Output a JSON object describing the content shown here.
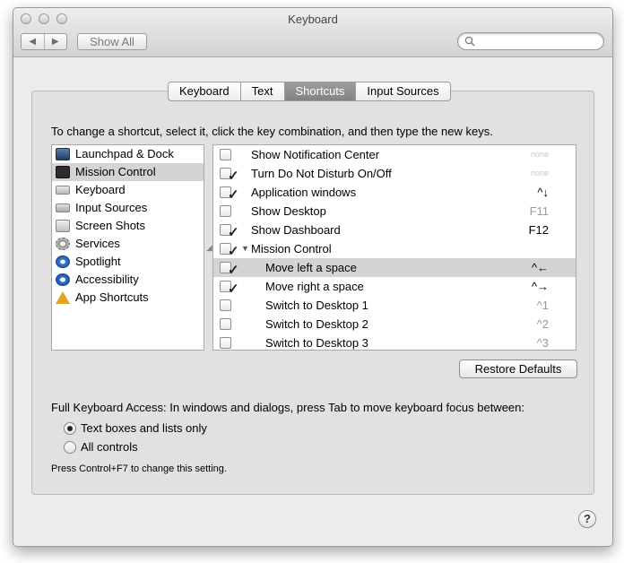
{
  "window": {
    "title": "Keyboard",
    "show_all_label": "Show All",
    "nav_back": "◀",
    "nav_forward": "▶",
    "search_placeholder": ""
  },
  "tabs": [
    {
      "label": "Keyboard",
      "active": false
    },
    {
      "label": "Text",
      "active": false
    },
    {
      "label": "Shortcuts",
      "active": true
    },
    {
      "label": "Input Sources",
      "active": false
    }
  ],
  "instructions": "To change a shortcut, select it, click the key combination, and then type the new keys.",
  "categories": [
    {
      "label": "Launchpad & Dock",
      "icon": "launchpad-icon",
      "selected": false
    },
    {
      "label": "Mission Control",
      "icon": "mission-control-icon",
      "selected": true
    },
    {
      "label": "Keyboard",
      "icon": "keyboard-icon",
      "selected": false
    },
    {
      "label": "Input Sources",
      "icon": "input-sources-icon",
      "selected": false
    },
    {
      "label": "Screen Shots",
      "icon": "screenshot-icon",
      "selected": false
    },
    {
      "label": "Services",
      "icon": "gear-icon",
      "selected": false
    },
    {
      "label": "Spotlight",
      "icon": "spotlight-icon",
      "selected": false
    },
    {
      "label": "Accessibility",
      "icon": "accessibility-icon",
      "selected": false
    },
    {
      "label": "App Shortcuts",
      "icon": "app-shortcuts-icon",
      "selected": false
    }
  ],
  "shortcuts": [
    {
      "label": "Show Notification Center",
      "checked": false,
      "key": "none",
      "key_style": "none",
      "indent": false,
      "group": false,
      "selected": false
    },
    {
      "label": "Turn Do Not Disturb On/Off",
      "checked": true,
      "key": "none",
      "key_style": "none",
      "indent": false,
      "group": false,
      "selected": false
    },
    {
      "label": "Application windows",
      "checked": true,
      "key": "^↓",
      "key_style": "normal",
      "indent": false,
      "group": false,
      "selected": false
    },
    {
      "label": "Show Desktop",
      "checked": false,
      "key": "F11",
      "key_style": "dim",
      "indent": false,
      "group": false,
      "selected": false
    },
    {
      "label": "Show Dashboard",
      "checked": true,
      "key": "F12",
      "key_style": "normal",
      "indent": false,
      "group": false,
      "selected": false
    },
    {
      "label": "Mission Control",
      "checked": true,
      "key": "",
      "key_style": "normal",
      "indent": false,
      "group": true,
      "selected": false
    },
    {
      "label": "Move left a space",
      "checked": true,
      "key": "^←",
      "key_style": "normal",
      "indent": true,
      "group": false,
      "selected": true
    },
    {
      "label": "Move right a space",
      "checked": true,
      "key": "^→",
      "key_style": "normal",
      "indent": true,
      "group": false,
      "selected": false
    },
    {
      "label": "Switch to Desktop 1",
      "checked": false,
      "key": "^1",
      "key_style": "dim",
      "indent": true,
      "group": false,
      "selected": false
    },
    {
      "label": "Switch to Desktop 2",
      "checked": false,
      "key": "^2",
      "key_style": "dim",
      "indent": true,
      "group": false,
      "selected": false
    },
    {
      "label": "Switch to Desktop 3",
      "checked": false,
      "key": "^3",
      "key_style": "dim",
      "indent": true,
      "group": false,
      "selected": false
    }
  ],
  "restore_defaults_label": "Restore Defaults",
  "full_keyboard_access": {
    "label": "Full Keyboard Access: In windows and dialogs, press Tab to move keyboard focus between:",
    "options": [
      {
        "label": "Text boxes and lists only",
        "selected": true
      },
      {
        "label": "All controls",
        "selected": false
      }
    ],
    "hint": "Press Control+F7 to change this setting."
  },
  "help_label": "?",
  "colors": {
    "selected_row": "#d4d4d4",
    "active_tab": "#8f8f8f",
    "window_bg": "#ececec"
  }
}
